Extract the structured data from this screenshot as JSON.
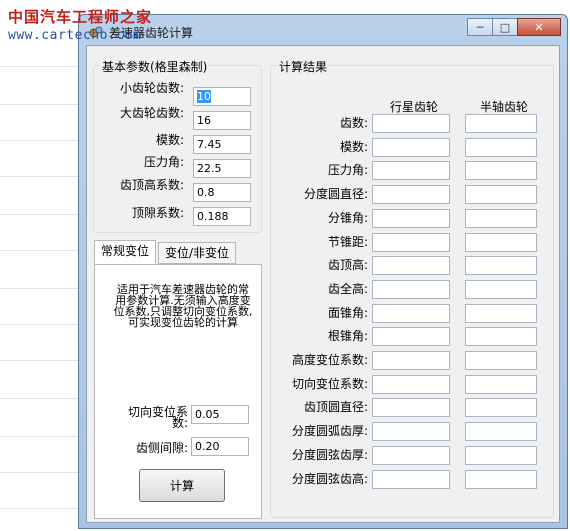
{
  "watermark": {
    "brand": "中国汽车工程师之家",
    "url": "www.cartecho.com"
  },
  "window": {
    "title": "差速器齿轮计算",
    "icon": "app-gear-icon",
    "buttons": {
      "minimize": "─",
      "maximize": "□",
      "close": "✕"
    }
  },
  "basic_params": {
    "title": "基本参数(格里森制)",
    "rows": [
      {
        "label": "小齿轮齿数:",
        "value": "10",
        "selected": true
      },
      {
        "label": "大齿轮齿数:",
        "value": "16"
      },
      {
        "label": "模数:",
        "value": "7.45"
      },
      {
        "label": "压力角:",
        "value": "22.5"
      },
      {
        "label": "齿顶高系数:",
        "value": "0.8"
      },
      {
        "label": "顶隙系数:",
        "value": "0.188"
      }
    ]
  },
  "tabs": {
    "items": [
      {
        "label": "常规变位",
        "active": true
      },
      {
        "label": "变位/非变位",
        "active": false
      }
    ],
    "description": "适用于汽车差速器齿轮的常用参数计算.无须输入高度变位系数,只调整切向变位系数,可实现变位齿轮的计算",
    "tangential_shift": {
      "label": "切向变位系数:",
      "value": "0.05"
    },
    "backlash": {
      "label": "齿侧间隙:",
      "value": "0.20"
    },
    "calc_button": "计算"
  },
  "results": {
    "title": "计算结果",
    "columns": [
      "行星齿轮",
      "半轴齿轮"
    ],
    "rows": [
      "齿数:",
      "模数:",
      "压力角:",
      "分度圆直径:",
      "分锥角:",
      "节锥距:",
      "齿顶高:",
      "齿全高:",
      "面锥角:",
      "根锥角:",
      "高度变位系数:",
      "切向变位系数:",
      "齿顶圆直径:",
      "分度圆弧齿厚:",
      "分度圆弦齿厚:",
      "分度圆弦齿高:"
    ]
  }
}
